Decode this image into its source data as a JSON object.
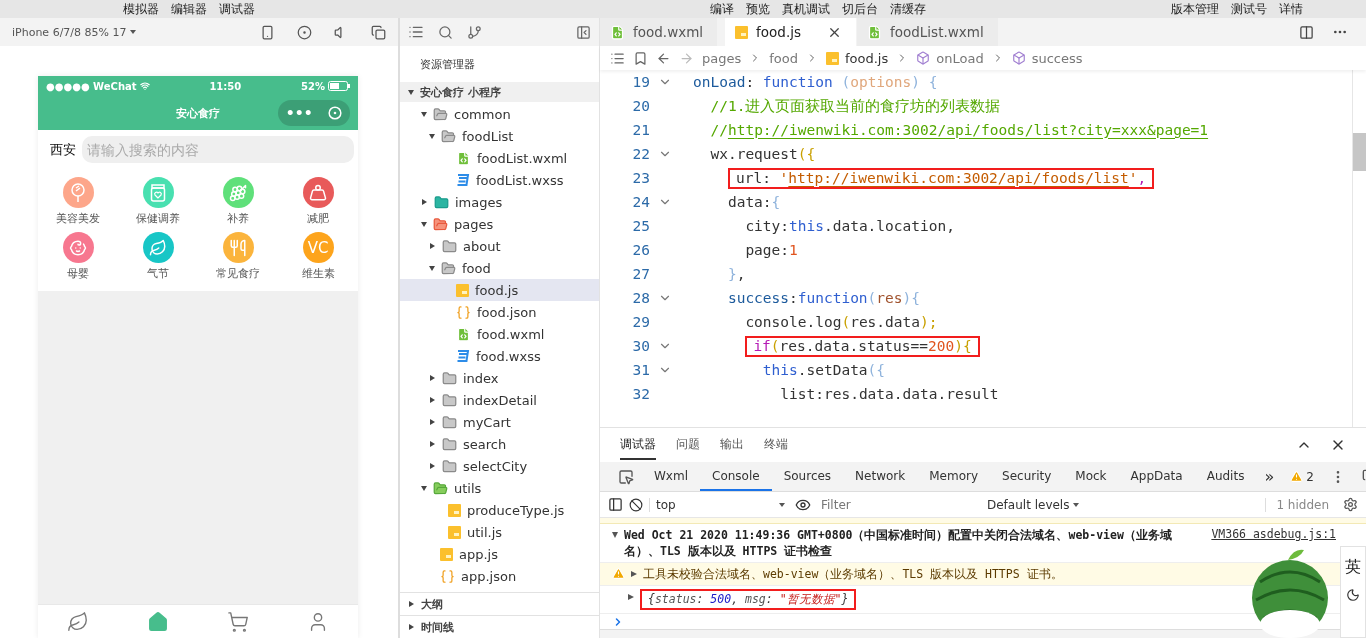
{
  "menu_bar": {
    "left": [
      "模拟器",
      "编辑器",
      "调试器"
    ],
    "center": [
      "编译",
      "预览",
      "真机调试",
      "切后台",
      "清缓存"
    ],
    "right": [
      "版本管理",
      "测试号",
      "详情"
    ]
  },
  "simulator": {
    "device": "iPhone 6/7/8 85% 17",
    "status_bar": {
      "carrier": "●●●●● WeChat",
      "time": "11:50",
      "battery": "52%"
    },
    "nav_title": "安心食疗",
    "capsule_dots": "•••",
    "city": "西安",
    "search": {
      "placeholder": "请输入搜索的内容"
    },
    "categories": [
      {
        "label": "美容美发",
        "kind": "mirror",
        "color": "#fda68a"
      },
      {
        "label": "保健调养",
        "kind": "jar",
        "color": "#48e0b0"
      },
      {
        "label": "补养",
        "kind": "grapes",
        "color": "#5fe07a"
      },
      {
        "label": "减肥",
        "kind": "weight",
        "color": "#e85a5a"
      },
      {
        "label": "母婴",
        "kind": "stroller",
        "color": "#f7778f"
      },
      {
        "label": "气节",
        "kind": "leaf",
        "color": "#18c6c6"
      },
      {
        "label": "常见食疗",
        "kind": "utensils",
        "color": "#fbb43c"
      },
      {
        "label": "维生素",
        "kind": "text",
        "text": "VC",
        "color": "#fda41c"
      }
    ],
    "tab_bar": [
      {
        "kind": "leaf",
        "selected": false
      },
      {
        "kind": "home",
        "selected": true
      },
      {
        "kind": "cart",
        "selected": false
      },
      {
        "kind": "user",
        "selected": false
      }
    ]
  },
  "explorer": {
    "title": "资源管理器",
    "project": {
      "name": "安心食疗 小程序",
      "expanded": true
    },
    "tree": [
      {
        "name": "common",
        "kind": "folder",
        "expanded": true,
        "selected": false,
        "children": [
          {
            "name": "foodList",
            "kind": "folder",
            "expanded": true,
            "selected": false,
            "children": [
              {
                "name": "foodList.wxml",
                "kind": "wxml",
                "selected": false
              },
              {
                "name": "foodList.wxss",
                "kind": "wxss",
                "selected": false
              }
            ]
          }
        ]
      },
      {
        "name": "images",
        "kind": "imagefolder",
        "expanded": false,
        "selected": false
      },
      {
        "name": "pages",
        "kind": "pagefolder",
        "expanded": true,
        "selected": false,
        "children": [
          {
            "name": "about",
            "kind": "folder",
            "expanded": false,
            "selected": false
          },
          {
            "name": "food",
            "kind": "folder",
            "expanded": true,
            "selected": false,
            "children": [
              {
                "name": "food.js",
                "kind": "js",
                "selected": true
              },
              {
                "name": "food.json",
                "kind": "json",
                "selected": false
              },
              {
                "name": "food.wxml",
                "kind": "wxml",
                "selected": false
              },
              {
                "name": "food.wxss",
                "kind": "wxss",
                "selected": false
              }
            ]
          },
          {
            "name": "index",
            "kind": "folder",
            "expanded": false,
            "selected": false
          },
          {
            "name": "indexDetail",
            "kind": "folder",
            "expanded": false,
            "selected": false
          },
          {
            "name": "myCart",
            "kind": "folder",
            "expanded": false,
            "selected": false
          },
          {
            "name": "search",
            "kind": "folder",
            "expanded": false,
            "selected": false
          },
          {
            "name": "selectCity",
            "kind": "folder",
            "expanded": false,
            "selected": false
          }
        ]
      },
      {
        "name": "utils",
        "kind": "utilfolder",
        "expanded": true,
        "selected": false,
        "children": [
          {
            "name": "produceType.js",
            "kind": "js",
            "selected": false
          },
          {
            "name": "util.js",
            "kind": "js",
            "selected": false
          }
        ]
      },
      {
        "name": "app.js",
        "kind": "js",
        "selected": false
      },
      {
        "name": "app.json",
        "kind": "json",
        "selected": false
      }
    ],
    "panels": [
      {
        "label": "大纲",
        "expanded": false
      },
      {
        "label": "时间线",
        "expanded": false
      }
    ]
  },
  "editor": {
    "tabs": [
      {
        "name": "food.wxml",
        "kind": "wxml",
        "selected": false
      },
      {
        "name": "food.js",
        "kind": "js",
        "selected": true
      },
      {
        "name": "foodList.wxml",
        "kind": "wxml",
        "selected": false
      }
    ],
    "breadcrumb": [
      {
        "text": "pages",
        "kind": "folder"
      },
      {
        "text": "food",
        "kind": "folder"
      },
      {
        "text": "food.js",
        "kind": "js"
      },
      {
        "text": "onLoad",
        "kind": "method"
      },
      {
        "text": "success",
        "kind": "method"
      }
    ],
    "lines": [
      {
        "num": "19",
        "fold": true,
        "boxed": false,
        "tokens": [
          {
            "t": "onLoad",
            "kind": "prop"
          },
          {
            "t": ": ",
            "kind": "plain"
          },
          {
            "t": "function",
            "kind": "keyword"
          },
          {
            "t": " (",
            "kind": "paren"
          },
          {
            "t": "options",
            "kind": "param"
          },
          {
            "t": ") {",
            "kind": "paren"
          }
        ]
      },
      {
        "num": "20",
        "fold": false,
        "boxed": false,
        "tokens": [
          {
            "t": "  //1.进入页面获取当前的食疗坊的列表数据",
            "kind": "comment"
          }
        ]
      },
      {
        "num": "21",
        "fold": false,
        "boxed": false,
        "tokens": [
          {
            "t": "  //",
            "kind": "comment"
          },
          {
            "t": "http://iwenwiki.com:3002/api/foods/list?city=xxx&page=1",
            "kind": "commentlink"
          }
        ]
      },
      {
        "num": "22",
        "fold": true,
        "boxed": false,
        "tokens": [
          {
            "t": "  wx.request",
            "kind": "plain"
          },
          {
            "t": "({",
            "kind": "bracket"
          }
        ]
      },
      {
        "num": "23",
        "fold": false,
        "boxed": true,
        "tokens": [
          {
            "t": "    url",
            "kind": "plain"
          },
          {
            "t": ": ",
            "kind": "plain"
          },
          {
            "t": "'",
            "kind": "string"
          },
          {
            "t": "http://iwenwiki.com:3002/api/foods/list",
            "kind": "stringlink"
          },
          {
            "t": "'",
            "kind": "string"
          },
          {
            "t": ",",
            "kind": "control"
          }
        ]
      },
      {
        "num": "24",
        "fold": true,
        "boxed": false,
        "tokens": [
          {
            "t": "    data:",
            "kind": "plain"
          },
          {
            "t": "{",
            "kind": "paren"
          }
        ]
      },
      {
        "num": "25",
        "fold": false,
        "boxed": false,
        "tokens": [
          {
            "t": "      city:",
            "kind": "plain"
          },
          {
            "t": "this",
            "kind": "keyword"
          },
          {
            "t": ".data.location,",
            "kind": "plain"
          }
        ]
      },
      {
        "num": "26",
        "fold": false,
        "boxed": false,
        "tokens": [
          {
            "t": "      page:",
            "kind": "plain"
          },
          {
            "t": "1",
            "kind": "number"
          }
        ]
      },
      {
        "num": "27",
        "fold": false,
        "boxed": false,
        "tokens": [
          {
            "t": "    }",
            "kind": "paren"
          },
          {
            "t": ",",
            "kind": "plain"
          }
        ]
      },
      {
        "num": "28",
        "fold": true,
        "boxed": false,
        "tokens": [
          {
            "t": "    success",
            "kind": "prop"
          },
          {
            "t": ":",
            "kind": "plain"
          },
          {
            "t": "function",
            "kind": "keyword"
          },
          {
            "t": "(",
            "kind": "paren"
          },
          {
            "t": "res",
            "kind": "arg"
          },
          {
            "t": "){",
            "kind": "paren"
          }
        ]
      },
      {
        "num": "29",
        "fold": false,
        "boxed": false,
        "tokens": [
          {
            "t": "      console.log",
            "kind": "plain"
          },
          {
            "t": "(",
            "kind": "bracket"
          },
          {
            "t": "res.data",
            "kind": "plain"
          },
          {
            "t": ");",
            "kind": "bracket"
          }
        ]
      },
      {
        "num": "30",
        "fold": true,
        "boxed": true,
        "tokens": [
          {
            "t": "      if",
            "kind": "control"
          },
          {
            "t": "(",
            "kind": "bracket"
          },
          {
            "t": "res.data.status==",
            "kind": "plain"
          },
          {
            "t": "200",
            "kind": "number"
          },
          {
            "t": "){",
            "kind": "bracket"
          }
        ]
      },
      {
        "num": "31",
        "fold": true,
        "boxed": false,
        "tokens": [
          {
            "t": "        this",
            "kind": "keyword"
          },
          {
            "t": ".setData",
            "kind": "plain"
          },
          {
            "t": "({",
            "kind": "paren"
          }
        ]
      },
      {
        "num": "32",
        "fold": false,
        "boxed": false,
        "tokens": [
          {
            "t": "          list:res.data.data.result",
            "kind": "plain"
          }
        ]
      }
    ]
  },
  "debugger": {
    "tabs": [
      {
        "label": "调试器",
        "selected": true
      },
      {
        "label": "问题",
        "selected": false
      },
      {
        "label": "输出",
        "selected": false
      },
      {
        "label": "终端",
        "selected": false
      }
    ],
    "devtools_tabs": [
      {
        "label": "Wxml",
        "selected": false
      },
      {
        "label": "Console",
        "selected": true
      },
      {
        "label": "Sources",
        "selected": false
      },
      {
        "label": "Network",
        "selected": false
      },
      {
        "label": "Memory",
        "selected": false
      },
      {
        "label": "Security",
        "selected": false
      },
      {
        "label": "Mock",
        "selected": false
      },
      {
        "label": "AppData",
        "selected": false
      },
      {
        "label": "Audits",
        "selected": false
      }
    ],
    "more_tabs": "»",
    "warnings": "2",
    "context": "top",
    "filter": {
      "placeholder": "Filter"
    },
    "levels": "Default levels",
    "hidden": "1 hidden",
    "messages": [
      {
        "kind": "group",
        "expanded": true,
        "text": "Wed Oct 21 2020 11:49:36 GMT+0800（中国标准时间）配置中关闭合法域名、web-view（业务域名）、TLS 版本以及 HTTPS 证书检查",
        "source": "VM366 asdebug.js:1"
      },
      {
        "kind": "warning",
        "expanded": false,
        "text": "工具未校验合法域名、web-view（业务域名）、TLS 版本以及 HTTPS 证书。"
      },
      {
        "kind": "object",
        "expanded": false,
        "boxed": true,
        "tokens": [
          {
            "t": "{",
            "kind": "plain"
          },
          {
            "t": "status",
            "kind": "key"
          },
          {
            "t": ": ",
            "kind": "plain"
          },
          {
            "t": "500",
            "kind": "num"
          },
          {
            "t": ", ",
            "kind": "plain"
          },
          {
            "t": "msg",
            "kind": "key"
          },
          {
            "t": ": ",
            "kind": "plain"
          },
          {
            "t": "\"暂无数据\"",
            "kind": "str"
          },
          {
            "t": "}",
            "kind": "plain"
          }
        ]
      }
    ]
  },
  "ime": {
    "label": "英"
  }
}
